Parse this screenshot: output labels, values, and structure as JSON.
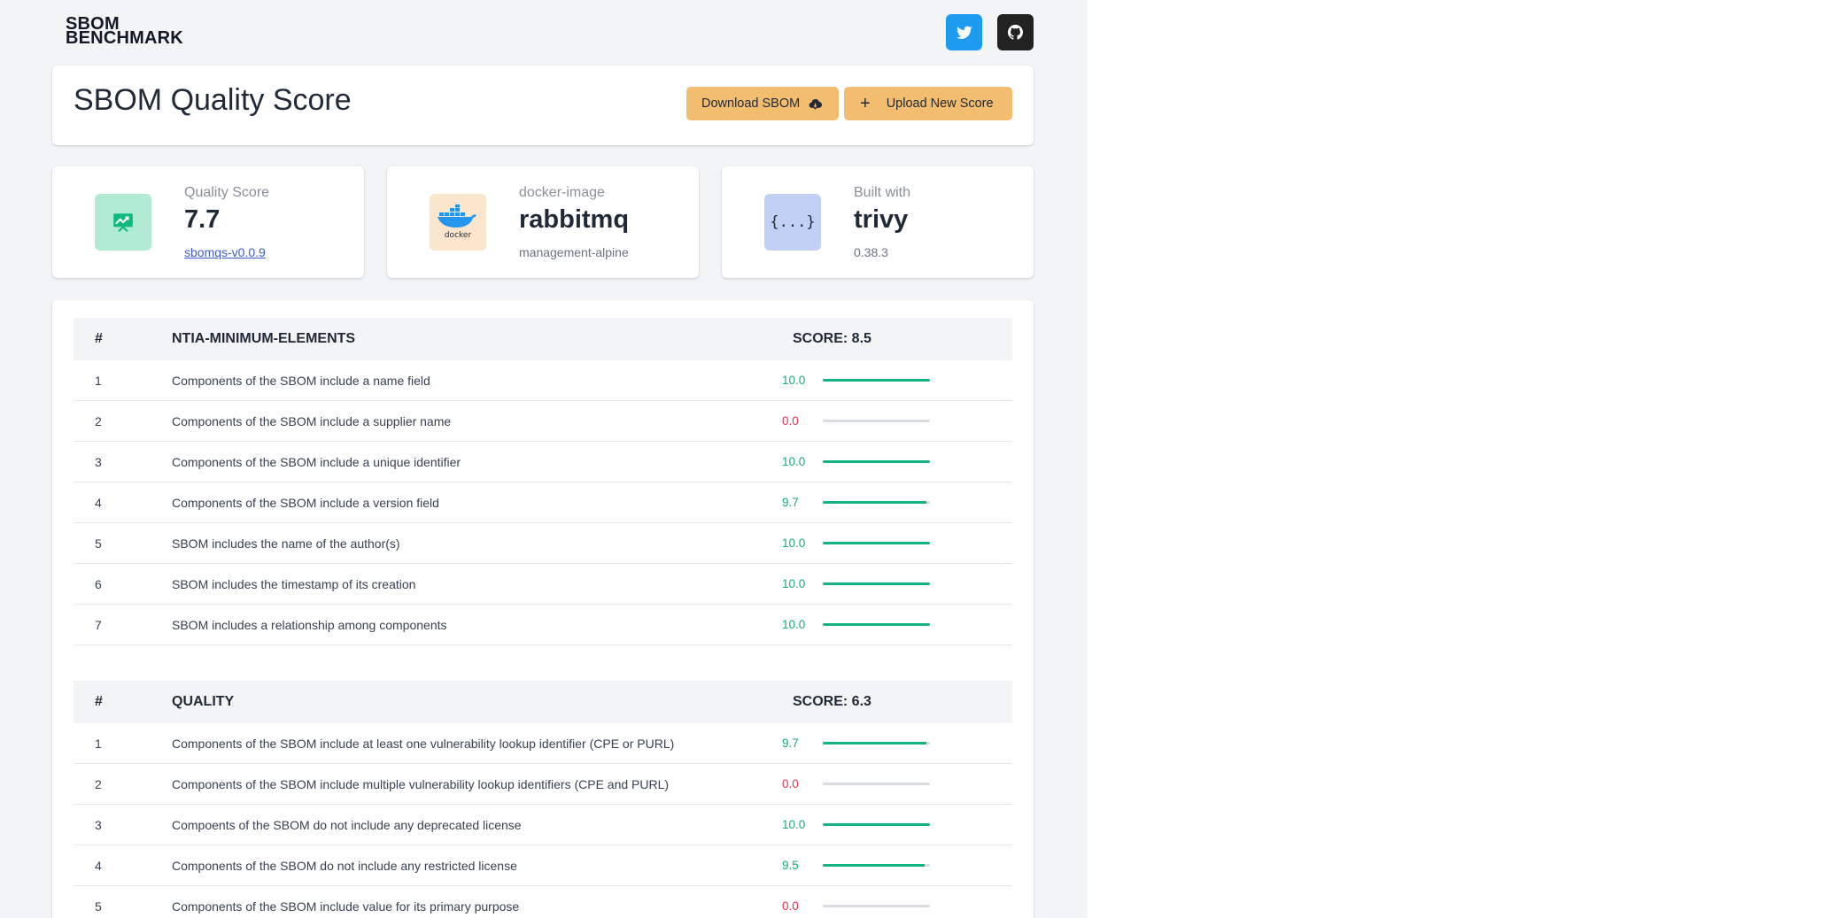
{
  "brand": {
    "line1": "SBOM",
    "line2": "BENCHMARK"
  },
  "colors": {
    "accent": "#f2bd6e",
    "good": "#18a979",
    "bad": "#e8304f",
    "twitter": "#1d9bf0",
    "github": "#222222"
  },
  "page": {
    "title": "SBOM Quality Score",
    "download_label": "Download SBOM",
    "upload_label": "Upload New Score"
  },
  "stats": [
    {
      "label": "Quality Score",
      "value": "7.7",
      "sub": "sbomqs-v0.0.9",
      "icon": "chart-icon"
    },
    {
      "label": "docker-image",
      "value": "rabbitmq",
      "sub": "management-alpine",
      "icon": "docker-icon",
      "icon_text": "docker"
    },
    {
      "label": "Built with",
      "value": "trivy",
      "sub": "0.38.3",
      "icon": "braces-icon",
      "icon_text": "{...}"
    }
  ],
  "sections": [
    {
      "num_header": "#",
      "title": "NTIA-MINIMUM-ELEMENTS",
      "score": "SCORE: 8.5",
      "rows": [
        {
          "num": "1",
          "desc": "Components of the SBOM include a name field",
          "value": "10.0",
          "score": 10.0
        },
        {
          "num": "2",
          "desc": "Components of the SBOM include a supplier name",
          "value": "0.0",
          "score": 0.0
        },
        {
          "num": "3",
          "desc": "Components of the SBOM include a unique identifier",
          "value": "10.0",
          "score": 10.0
        },
        {
          "num": "4",
          "desc": "Components of the SBOM include a version field",
          "value": "9.7",
          "score": 9.7
        },
        {
          "num": "5",
          "desc": "SBOM includes the name of the author(s)",
          "value": "10.0",
          "score": 10.0
        },
        {
          "num": "6",
          "desc": "SBOM includes the timestamp of its creation",
          "value": "10.0",
          "score": 10.0
        },
        {
          "num": "7",
          "desc": "SBOM includes a relationship among components",
          "value": "10.0",
          "score": 10.0
        }
      ]
    },
    {
      "num_header": "#",
      "title": "QUALITY",
      "score": "SCORE: 6.3",
      "rows": [
        {
          "num": "1",
          "desc": "Components of the SBOM include at least one vulnerability lookup identifier (CPE or PURL)",
          "value": "9.7",
          "score": 9.7
        },
        {
          "num": "2",
          "desc": "Components of the SBOM include multiple vulnerability lookup identifiers (CPE and PURL)",
          "value": "0.0",
          "score": 0.0
        },
        {
          "num": "3",
          "desc": "Compoents of the SBOM do not include any deprecated license",
          "value": "10.0",
          "score": 10.0
        },
        {
          "num": "4",
          "desc": "Components of the SBOM do not include any restricted license",
          "value": "9.5",
          "score": 9.5
        },
        {
          "num": "5",
          "desc": "Components of the SBOM include value for its primary purpose",
          "value": "0.0",
          "score": 0.0
        }
      ]
    }
  ]
}
